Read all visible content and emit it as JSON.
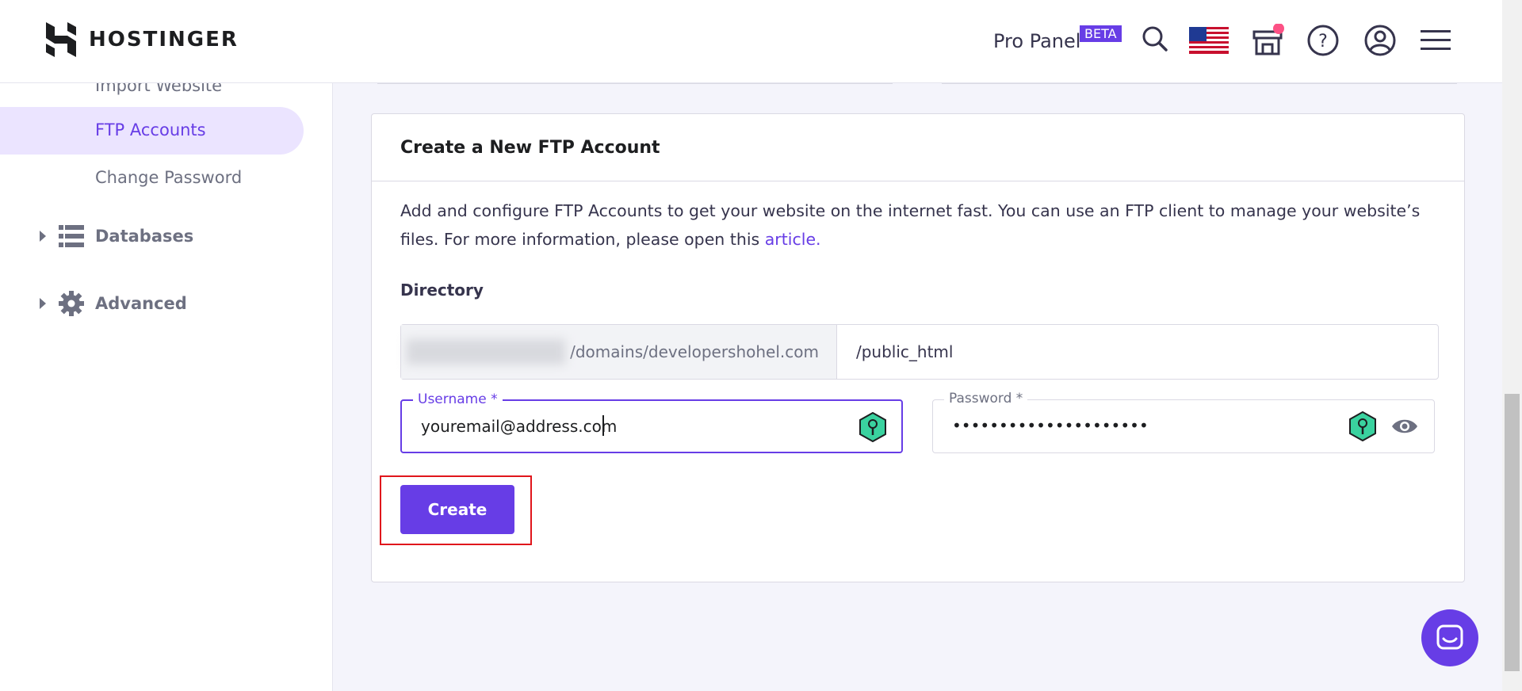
{
  "brand": {
    "name": "HOSTINGER"
  },
  "header": {
    "pro_panel": "Pro Panel",
    "beta": "BETA"
  },
  "sidebar": {
    "items": [
      {
        "label": "Import Website"
      },
      {
        "label": "FTP Accounts"
      },
      {
        "label": "Change Password"
      }
    ],
    "sections": [
      {
        "label": "Databases"
      },
      {
        "label": "Advanced"
      }
    ]
  },
  "card": {
    "title": "Create a New FTP Account",
    "description": "Add and configure FTP Accounts to get your website on the internet fast. You can use an FTP client to manage your website’s files. For more information, please open this ",
    "link": "article.",
    "directory_label": "Directory",
    "directory_prefix": "/domains/developershohel.com",
    "directory_suffix": "/public_html",
    "username_label": "Username *",
    "username_value": "youremail@address.com",
    "password_label": "Password *",
    "password_value": "•••••••••••••••••••••",
    "create_label": "Create"
  },
  "colors": {
    "accent": "#673de6",
    "highlight": "#e0161c",
    "active_bg": "#ebe4ff"
  }
}
